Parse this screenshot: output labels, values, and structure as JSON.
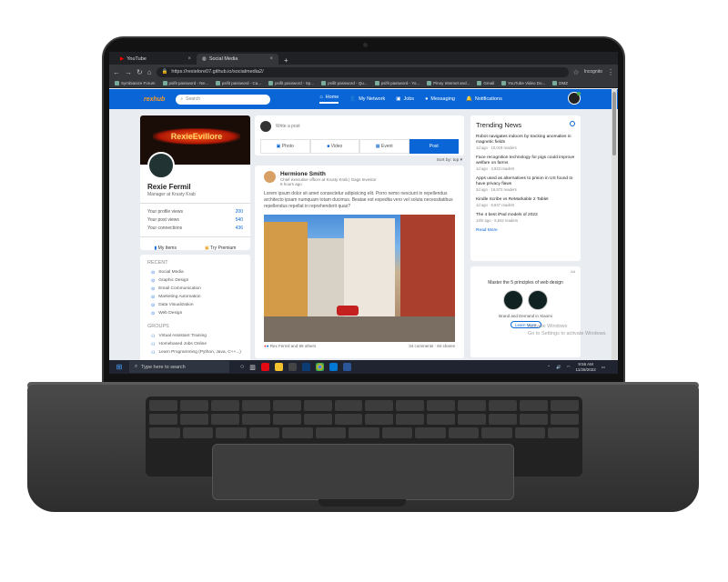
{
  "browser": {
    "tabs": [
      {
        "label": "YouTube",
        "active": false
      },
      {
        "label": "Social Media",
        "active": true
      }
    ],
    "url": "https://rexielore07.github.io/socialmedia2/",
    "profile": "Incognito",
    "bookmarks": [
      "Symbianize Forum",
      "psifit password - Ne...",
      "psifit password - Ca...",
      "psifit password - Sp...",
      "psifit password - Qu...",
      "psifit password - Yo...",
      "Pinoy Internet and...",
      "Gmail",
      "YouTube Video Do...",
      "DMZ"
    ]
  },
  "site": {
    "logo": "rexhub",
    "search_placeholder": "Search",
    "nav": [
      "Home",
      "My Network",
      "Jobs",
      "Messaging",
      "Notifications"
    ]
  },
  "profile": {
    "cover_text": "RexieEvillore",
    "name": "Rexie Fermil",
    "title": "Manager at Krusty Krab",
    "stats": [
      {
        "label": "Your profile views",
        "value": "200"
      },
      {
        "label": "Your post views",
        "value": "540"
      },
      {
        "label": "Your connections",
        "value": "436"
      }
    ],
    "buttons": [
      "My Items",
      "Try Premium"
    ]
  },
  "sidebar": {
    "recent_title": "RECENT",
    "recent": [
      "Social Media",
      "Graphic Design",
      "Email Communication",
      "Marketing Automation",
      "Data Visualization",
      "Web Design"
    ],
    "groups_title": "GROUPS",
    "groups": [
      "Virtual Assistant Training",
      "Homebased Jobs Online",
      "Learn Programming (Python, Java, C++...)"
    ]
  },
  "composer": {
    "placeholder": "Write a post",
    "buttons": [
      "Photo",
      "Video",
      "Event",
      "Post"
    ],
    "sort": "Sort by: top"
  },
  "feed_post": {
    "author": "Hermione Smith",
    "subtitle": "Chief executive officer at Krusty Krab | Gags Investor",
    "time": "5 hours ago",
    "text": "Lorem ipsum dolor sit amet consectetur adipisicing elit. Porro nemo nesciunt in repellendus architecto ipsam numquam totam ducimus. Beatae est expedita vero vel soluta necessitatibus repellendus repellat in reprehenderit quas?",
    "reactions": "Rex Fermil and 89 others",
    "comments": "34 comments",
    "shares": "84 shares"
  },
  "trending": {
    "title": "Trending News",
    "items": [
      {
        "title": "Robot navigates indoors by tracking anomalies in magnetic fields",
        "meta": "1d ago · 10,019 readers"
      },
      {
        "title": "Face recognition technology for pigs could improve welfare on farms",
        "meta": "1d ago · 3,923 readers"
      },
      {
        "title": "Apps used as alternatives to prison in US found to have privacy flaws",
        "meta": "2d ago · 16,672 readers"
      },
      {
        "title": "Kindle Scribe vs ReMarkable 2 Tablet",
        "meta": "1d ago · 9,847 readers"
      },
      {
        "title": "The 4 best iPad models of 2022",
        "meta": "14hr ago · 5,642 readers"
      }
    ],
    "read_more": "Read More"
  },
  "ad": {
    "label": "Ad",
    "headline": "Master the 5 principles of web design",
    "caption": "Brand and Demand in Xiaomi",
    "button": "Learn More"
  },
  "watermark": [
    "Activate Windows",
    "Go to Settings to activate Windows."
  ],
  "taskbar": {
    "search_placeholder": "Type here to search",
    "time": "9:56 AM",
    "date": "11/28/2022"
  }
}
